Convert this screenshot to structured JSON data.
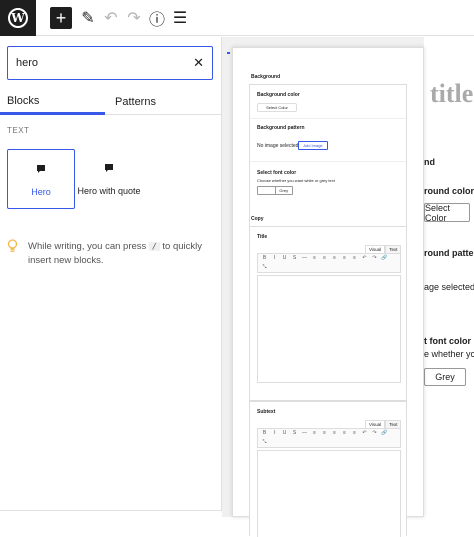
{
  "toolbar": {
    "logo_letter": "W",
    "add_symbol": "+",
    "pencil_symbol": "✎",
    "undo_symbol": "↶",
    "redo_symbol": "↷",
    "info_symbol": "ⓘ",
    "list_symbol": "☰"
  },
  "inserter": {
    "search_value": "hero",
    "clear_symbol": "✕",
    "tabs": {
      "blocks": "Blocks",
      "patterns": "Patterns"
    },
    "section_label": "TEXT",
    "items": [
      {
        "label": "Hero"
      },
      {
        "label": "Hero with quote"
      }
    ],
    "tip": {
      "before": "While writing, you can press ",
      "key": "/",
      "after": " to quickly insert new blocks."
    }
  },
  "preview": {
    "background_heading": "Background",
    "bg_color_label": "Background color",
    "select_color": "Select Color",
    "bg_pattern_label": "Background pattern",
    "no_image": "No image selected",
    "add_image": "Add Image",
    "font_color_label": "Select font color",
    "font_color_help": "Choose whether you want white or grey text",
    "grey_label": "Grey",
    "copy_heading": "Copy",
    "title_label": "Title",
    "subtext_label": "Subtext",
    "visual": "Visual",
    "text": "Text"
  },
  "canvas_ghost": {
    "title": "title",
    "background_fragment": "nd",
    "bg_color_fragment": "round color",
    "select_color": "Select Color",
    "pattern_fragment": "round patte",
    "image_fragment": "age selected",
    "font_color_fragment": "t font color",
    "help_fragment": "e whether yc",
    "grey": "Grey"
  }
}
